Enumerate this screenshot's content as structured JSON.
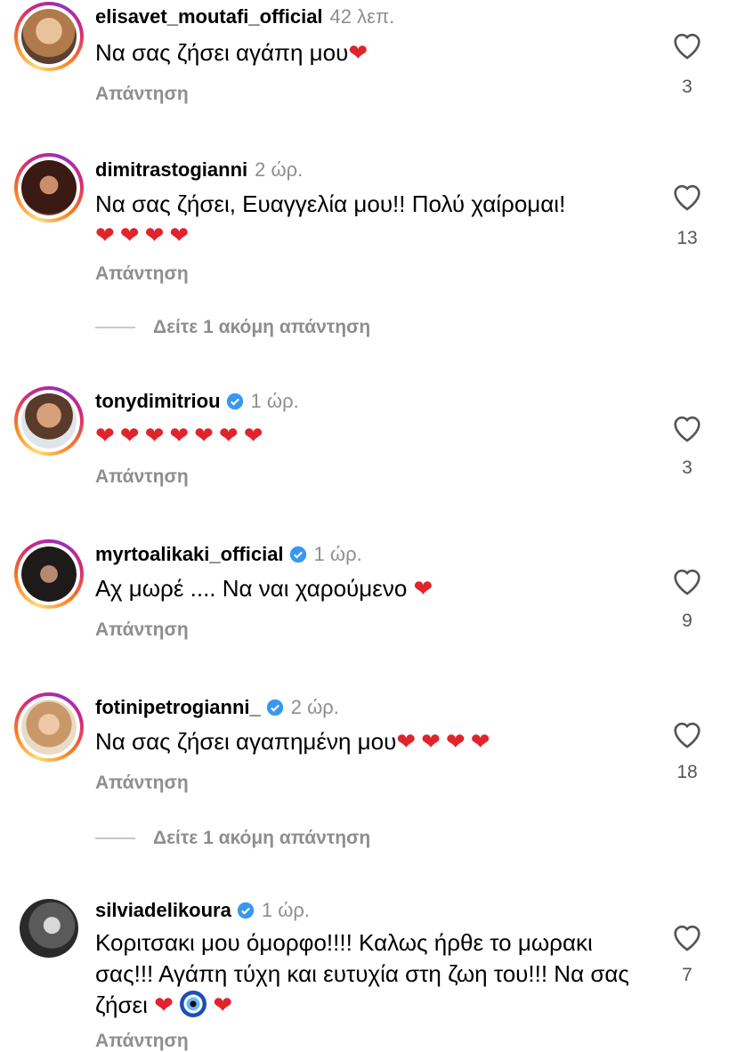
{
  "comments": [
    {
      "user": "elisavet_moutafi_official",
      "time": "42 λεπ.",
      "verified": false,
      "text": "Να σας ζήσει αγάπη μου",
      "hearts": "❤",
      "likes": "3",
      "reply": "Απάντηση",
      "more": ""
    },
    {
      "user": "dimitrastogianni",
      "time": "2 ώρ.",
      "verified": false,
      "text": "Να σας ζήσει, Ευαγγελία μου!! Πολύ χαίρομαι!",
      "hearts": "❤❤❤❤",
      "likes": "13",
      "reply": "Απάντηση",
      "more": "Δείτε 1 ακόμη απάντηση"
    },
    {
      "user": "tonydimitriou",
      "time": "1 ώρ.",
      "verified": true,
      "text": "",
      "hearts": "❤❤❤❤❤❤❤",
      "likes": "3",
      "reply": "Απάντηση",
      "more": ""
    },
    {
      "user": "myrtoalikaki_official",
      "time": "1 ώρ.",
      "verified": true,
      "text": "Αχ μωρέ .... Να ναι χαρούμενο ",
      "hearts": "❤",
      "likes": "9",
      "reply": "Απάντηση",
      "more": ""
    },
    {
      "user": "fotinipetrogianni_",
      "time": "2 ώρ.",
      "verified": true,
      "text": "Να σας ζήσει αγαπημένη μου",
      "hearts": "❤❤❤❤",
      "likes": "18",
      "reply": "Απάντηση",
      "more": "Δείτε 1 ακόμη απάντηση"
    },
    {
      "user": "silviadelikoura",
      "time": "1 ώρ.",
      "verified": true,
      "text": "Κοριτσακι μου όμορφο!!!! Καλως ήρθε το μωρακι σας!!! Αγάπη τύχη και ευτυχία στη ζωη του!!! Να σας ζήσει ",
      "hearts": "❤",
      "likes": "7",
      "reply": "Απάντηση",
      "more": ""
    }
  ],
  "colors": {
    "accent_red": "#e0242b",
    "muted": "#8e8e8e",
    "verified": "#3897f0"
  }
}
